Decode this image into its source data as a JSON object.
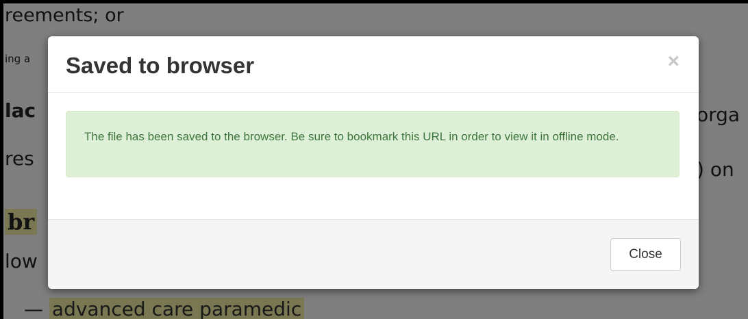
{
  "background": {
    "line1": "reements; or",
    "line2": "ing a",
    "line3a": "lac",
    "line3b": "orga",
    "line4a": "res",
    "line4b": ") on",
    "line5": "br",
    "line6": "low",
    "line7_dash": "—",
    "line7_highlight": "advanced care paramedic"
  },
  "modal": {
    "title": "Saved to browser",
    "close_symbol": "×",
    "alert_text": "The file has been saved to the browser. Be sure to bookmark this URL in order to view it in offline mode.",
    "footer_button_label": "Close"
  },
  "colors": {
    "alert_bg": "#dff0d8",
    "alert_text": "#3c763d",
    "highlight": "#f2f0a6"
  }
}
